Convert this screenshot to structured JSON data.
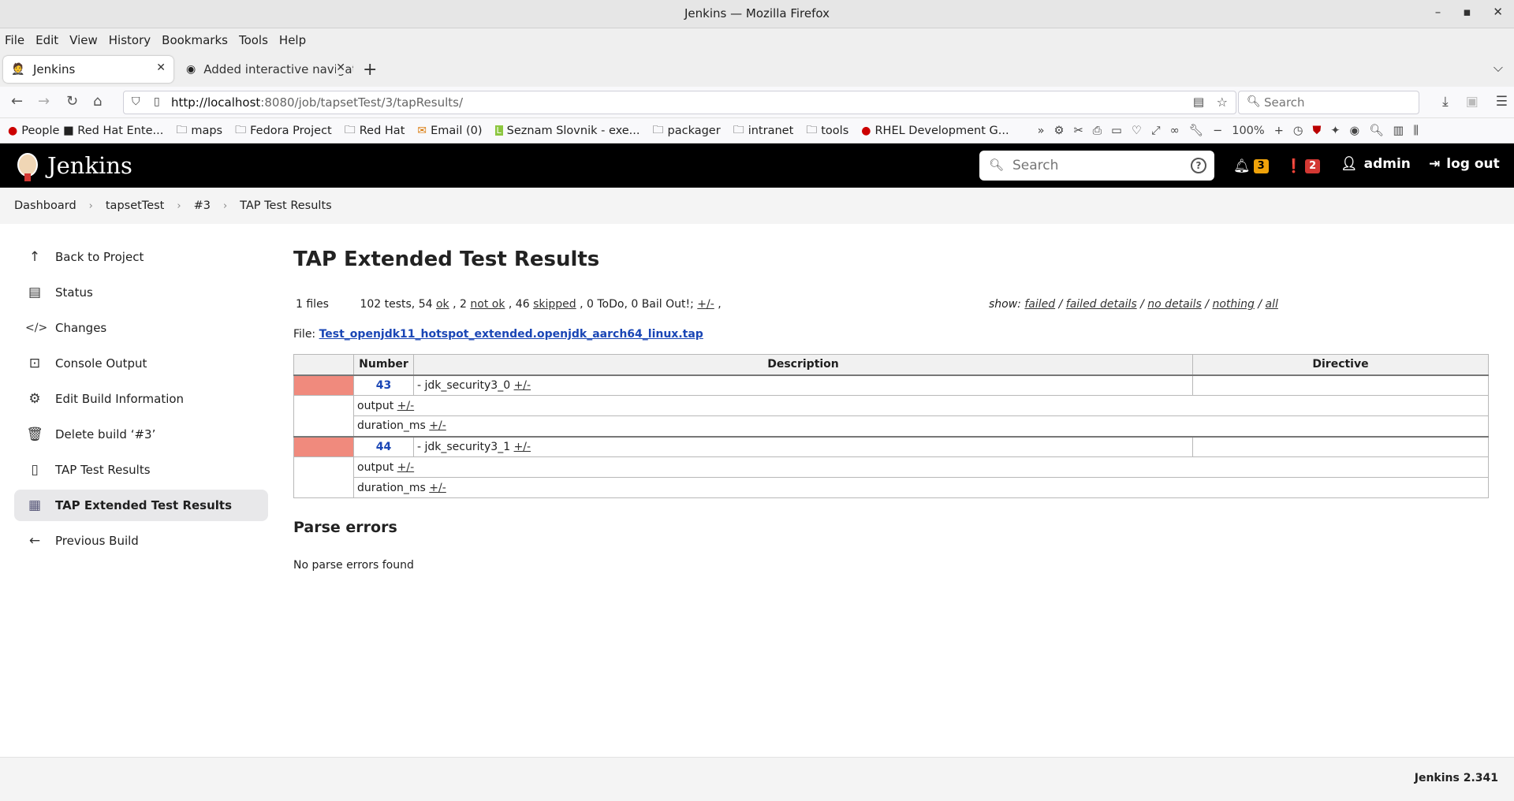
{
  "browser": {
    "window_title": "Jenkins — Mozilla Firefox",
    "menu": [
      "File",
      "Edit",
      "View",
      "History",
      "Bookmarks",
      "Tools",
      "Help"
    ],
    "tabs": [
      {
        "label": "Jenkins"
      },
      {
        "label": "Added interactive navigati"
      }
    ],
    "url_host": "http://localhost",
    "url_rest": ":8080/job/tapsetTest/3/tapResults/",
    "search_placeholder": "Search",
    "bookmarks": [
      "People ■ Red Hat Ente...",
      "maps",
      "Fedora Project",
      "Red Hat",
      "Email (0)",
      "Seznam Slovnik - exe...",
      "packager",
      "intranet",
      "tools",
      "RHEL Development G..."
    ],
    "zoom": "100%"
  },
  "jenkins": {
    "logo_text": "Jenkins",
    "search_placeholder": "Search",
    "notifications_count": "3",
    "security_count": "2",
    "user": "admin",
    "logout": "log out"
  },
  "breadcrumb": [
    "Dashboard",
    "tapsetTest",
    "#3",
    "TAP Test Results"
  ],
  "sidebar": [
    {
      "label": "Back to Project",
      "icon": "arrow-up-icon"
    },
    {
      "label": "Status",
      "icon": "document-icon"
    },
    {
      "label": "Changes",
      "icon": "code-icon"
    },
    {
      "label": "Console Output",
      "icon": "terminal-icon"
    },
    {
      "label": "Edit Build Information",
      "icon": "gear-icon"
    },
    {
      "label": "Delete build ‘#3’",
      "icon": "trash-icon"
    },
    {
      "label": "TAP Test Results",
      "icon": "clipboard-icon"
    },
    {
      "label": "TAP Extended Test Results",
      "icon": "tap-icon"
    },
    {
      "label": "Previous Build",
      "icon": "arrow-left-icon"
    }
  ],
  "main": {
    "title": "TAP Extended Test Results",
    "files": "1 files",
    "summary": {
      "tests": "102 tests, 54 ",
      "ok": "ok",
      "mid1": " , 2 ",
      "not_ok": "not ok",
      "mid2": " , 46 ",
      "skipped": "skipped",
      "tail": " , 0 ToDo, 0 Bail Out!; ",
      "toggle": "+/-",
      "comma": " ,"
    },
    "show": {
      "label": "show: ",
      "failed": "failed",
      "failed_details": "failed details",
      "no_details": "no details",
      "nothing": "nothing",
      "all": "all",
      "sep": " / "
    },
    "file_label": "File: ",
    "file_name": "Test_openjdk11_hotspot_extended.openjdk_aarch64_linux.tap",
    "table_headers": [
      "Number",
      "Description",
      "Directive"
    ],
    "rows": [
      {
        "number": "43",
        "description": "- jdk_security3_0 ",
        "toggle": "+/-"
      },
      {
        "number": "44",
        "description": "- jdk_security3_1 ",
        "toggle": "+/-"
      }
    ],
    "sub_rows": [
      "output ",
      "duration_ms "
    ],
    "parse_errors_title": "Parse errors",
    "parse_errors_msg": "No parse errors found"
  },
  "footer": {
    "version": "Jenkins 2.341"
  }
}
